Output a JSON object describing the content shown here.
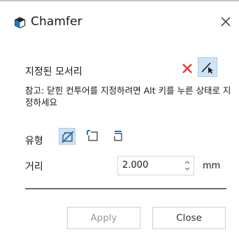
{
  "window": {
    "title": "Chamfer",
    "close_icon": "close-icon",
    "app_icon": "chamfer-cube-icon"
  },
  "selected_edges": {
    "label": "지정된 모서리",
    "clear_icon": "clear-selection-x-icon",
    "pick_icon": "edge-pick-cursor-icon",
    "clear_color": "#e53935"
  },
  "hint": "참고: 닫힌 컨투어를 지정하려면 Alt 키를 누른 상태로 지정하세요",
  "type": {
    "label": "유형",
    "options": [
      {
        "icon": "chamfer-type-1-icon",
        "selected": true
      },
      {
        "icon": "chamfer-type-2-icon",
        "selected": false
      },
      {
        "icon": "chamfer-type-3-icon",
        "selected": false
      }
    ]
  },
  "distance": {
    "label": "거리",
    "value": "2.000",
    "unit": "mm"
  },
  "buttons": {
    "apply": "Apply",
    "close": "Close"
  },
  "colors": {
    "accent": "#1e78c8",
    "selected_bg": "#cfe3f7"
  }
}
